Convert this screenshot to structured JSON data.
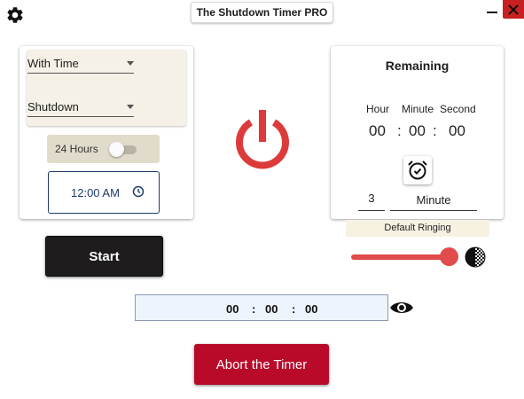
{
  "window": {
    "title": "The Shutdown Timer PRO",
    "minimize_icon": "minimize-icon",
    "close_icon": "close-icon",
    "settings_icon": "gear-icon"
  },
  "left_panel": {
    "mode_select": "With Time",
    "action_select": "Shutdown",
    "format_toggle_label": "24 Hours",
    "format_toggle_on": false,
    "time_value": "12:00 AM",
    "time_icon": "clock-icon",
    "start_label": "Start"
  },
  "power_icon": "power-icon",
  "right_panel": {
    "title": "Remaining",
    "labels": {
      "hour": "Hour",
      "minute": "Minute",
      "second": "Second"
    },
    "values": {
      "hour": "00",
      "sep1": ":",
      "minute": "00",
      "sep2": ":",
      "second": "00"
    },
    "alarm_icon": "alarm-clock-icon",
    "reminder_amount": "3",
    "reminder_unit": "Minute"
  },
  "ringing": {
    "label": "Default Ringing",
    "volume_percent": 100,
    "contrast_icon": "contrast-icon"
  },
  "countdown": {
    "hours": "00",
    "sep1": ":",
    "minutes": "00",
    "sep2": ":",
    "seconds": "00",
    "visibility_icon": "eye-icon"
  },
  "abort_label": "Abort the Timer",
  "colors": {
    "accent_red": "#b90a2a",
    "power_red": "#dd3b3b",
    "start_dark": "#1e1c1c",
    "panel_beige": "#f5f1e6"
  }
}
